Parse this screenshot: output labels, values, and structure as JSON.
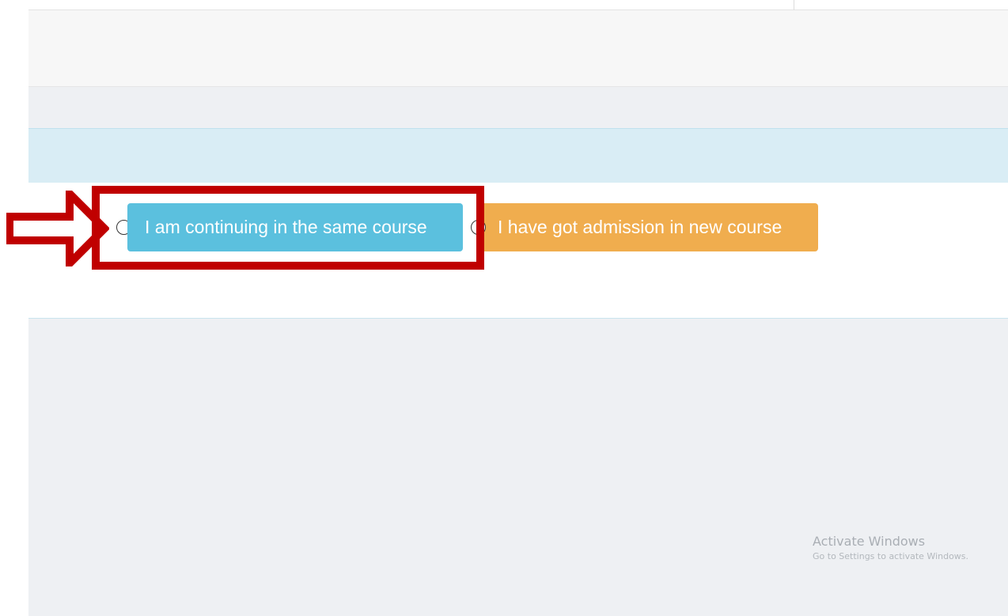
{
  "options": {
    "continuing": {
      "label": "I am continuing in the same course",
      "selected": false,
      "color": "#5bc0de"
    },
    "new_admission": {
      "label": "I have got admission in new course",
      "selected": false,
      "color": "#f0ad4e"
    }
  },
  "annotation": {
    "arrow_icon": "right-arrow-icon",
    "highlight_color": "#c00000"
  },
  "watermark": {
    "title": "Activate Windows",
    "subtitle": "Go to Settings to activate Windows."
  }
}
